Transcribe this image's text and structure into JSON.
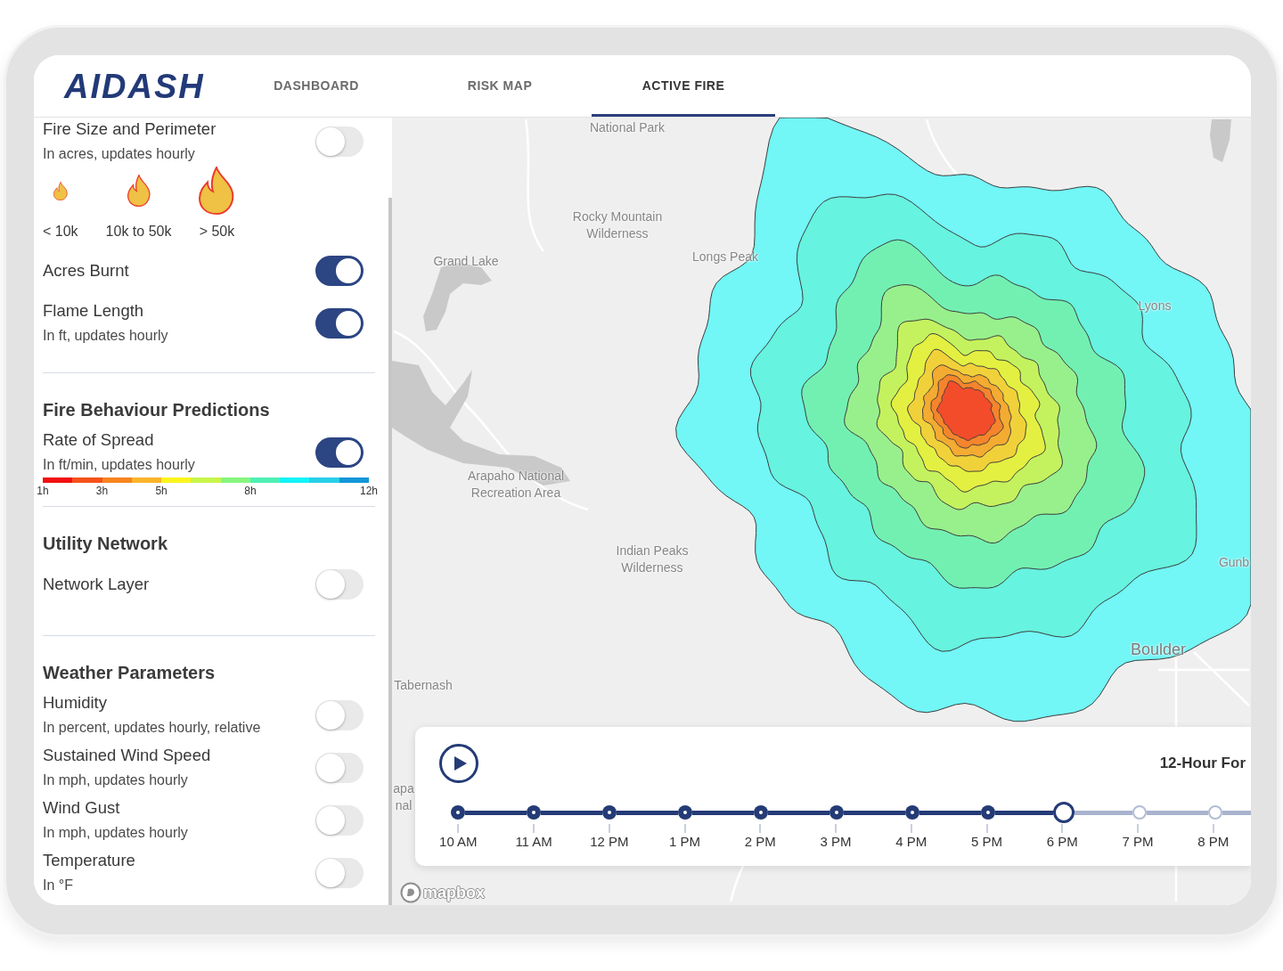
{
  "header": {
    "logo": "AIDASH",
    "tabs": [
      {
        "label": "DASHBOARD",
        "selected": false
      },
      {
        "label": "RISK MAP",
        "selected": false
      },
      {
        "label": "ACTIVE FIRE",
        "selected": true
      }
    ]
  },
  "layers_panel": {
    "sections": [
      {
        "items": [
          {
            "kind": "toggle",
            "title": "Fire Size and Perimeter",
            "subtitle": "In acres, updates hourly",
            "on": false
          },
          {
            "kind": "flame_legend",
            "entries": [
              {
                "kind": "small",
                "label": "< 10k"
              },
              {
                "kind": "medium",
                "label": "10k to 50k"
              },
              {
                "kind": "large",
                "label": "> 50k"
              }
            ]
          },
          {
            "kind": "toggle",
            "title": "Acres Burnt",
            "on": true
          },
          {
            "kind": "toggle",
            "title": "Flame Length",
            "subtitle": "In ft, updates hourly",
            "on": true
          }
        ]
      },
      {
        "heading": "Fire Behaviour Predictions",
        "items": [
          {
            "kind": "toggle",
            "title": "Rate of Spread",
            "subtitle": "In ft/min, updates hourly",
            "on": true
          },
          {
            "kind": "color_scale",
            "segments": [
              {
                "color": "#f20f0f",
                "start_label": "1h"
              },
              {
                "color": "#f5521a"
              },
              {
                "color": "#f7841f",
                "start_label": "3h"
              },
              {
                "color": "#fbb42a"
              },
              {
                "color": "#fbf41e",
                "start_label": "5h"
              },
              {
                "color": "#c8f54b"
              },
              {
                "color": "#88f57f"
              },
              {
                "color": "#4ff0b4",
                "start_label": "8h"
              },
              {
                "color": "#10f4f8"
              },
              {
                "color": "#28cfe9"
              },
              {
                "color": "#1296d8",
                "end_label": "12h"
              }
            ]
          }
        ]
      },
      {
        "heading": "Utility Network",
        "items": [
          {
            "kind": "toggle",
            "title": "Network Layer",
            "on": false
          }
        ]
      },
      {
        "heading": "Weather Parameters",
        "items": [
          {
            "kind": "toggle",
            "title": "Humidity",
            "subtitle": "In percent, updates hourly, relative",
            "on": false
          },
          {
            "kind": "toggle",
            "title": "Sustained Wind Speed",
            "subtitle": "In mph, updates hourly",
            "on": false
          },
          {
            "kind": "toggle",
            "title": "Wind Gust",
            "subtitle": "In mph, updates hourly",
            "on": false
          },
          {
            "kind": "toggle",
            "title": "Temperature",
            "subtitle": "In °F",
            "on": false
          }
        ]
      }
    ]
  },
  "map": {
    "labels": [
      {
        "kind": "place",
        "text": "National Park"
      },
      {
        "kind": "place",
        "text": "Rocky Mountain\nWilderness"
      },
      {
        "kind": "place",
        "text": "Grand Lake"
      },
      {
        "kind": "place",
        "text": "Longs Peak"
      },
      {
        "kind": "place",
        "text": "Lyons"
      },
      {
        "kind": "place",
        "text": "Arapaho National\nRecreation Area"
      },
      {
        "kind": "place",
        "text": "Indian Peaks\nWilderness"
      },
      {
        "kind": "place",
        "text": "Tabernash"
      },
      {
        "kind": "city",
        "text": "Boulder"
      },
      {
        "kind": "place",
        "text": "Gunb"
      },
      {
        "kind": "place",
        "text": "apa\nnal"
      }
    ],
    "attribution": "mapbox"
  },
  "timeline": {
    "title": "12-Hour For",
    "steps": [
      {
        "label": "10 AM",
        "selected": false
      },
      {
        "label": "11 AM",
        "selected": false
      },
      {
        "label": "12 PM",
        "selected": false
      },
      {
        "label": "1 PM",
        "selected": false
      },
      {
        "label": "2 PM",
        "selected": false
      },
      {
        "label": "3 PM",
        "selected": false
      },
      {
        "label": "4 PM",
        "selected": false
      },
      {
        "label": "5 PM",
        "selected": false
      },
      {
        "label": "6 PM",
        "selected": true
      },
      {
        "label": "7 PM",
        "selected": false
      },
      {
        "label": "8 PM",
        "selected": false
      }
    ]
  }
}
